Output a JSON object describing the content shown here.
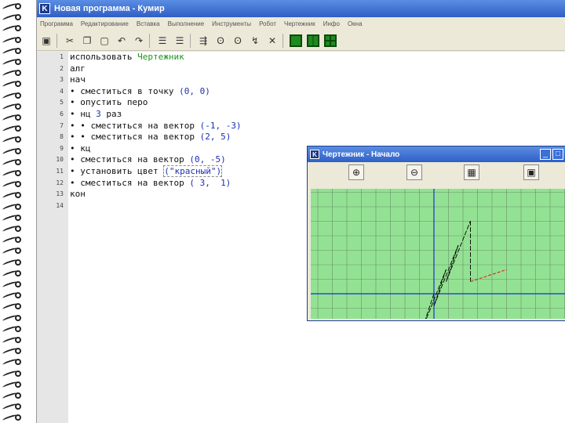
{
  "window": {
    "title": "Новая программа - Кумир",
    "icon_letter": "K"
  },
  "menu": [
    "Программа",
    "Редактирование",
    "Вставка",
    "Выполнение",
    "Инструменты",
    "Робот",
    "Чертежник",
    "Инфо",
    "Окна"
  ],
  "toolbar_icons": [
    "save-icon",
    "cut-icon",
    "copy-icon",
    "paste-icon",
    "undo-icon",
    "redo-icon",
    "indent-icon",
    "unindent-icon",
    "compile-icon",
    "run-icon",
    "step-into-icon",
    "step-over-icon",
    "stop-icon",
    "robot-window-icon",
    "drawer-window-icon",
    "field-window-icon"
  ],
  "toolbar_glyphs": [
    "▣",
    "✂",
    "❐",
    "▢",
    "↶",
    "↷",
    "☰",
    "☰",
    "⇶",
    "ʘ",
    "ʘ",
    "↯",
    "✕"
  ],
  "code": {
    "line_numbers": [
      "1",
      "2",
      "3",
      "4",
      "5",
      "6",
      "7",
      "8",
      "9",
      "10",
      "11",
      "12",
      "13",
      "14"
    ],
    "lines": [
      [
        {
          "t": "использовать ",
          "c": ""
        },
        {
          "t": "Чертежник",
          "c": "kw-green"
        }
      ],
      [
        {
          "t": "алг",
          "c": ""
        }
      ],
      [
        {
          "t": "нач",
          "c": ""
        }
      ],
      [
        {
          "t": "• сместиться в точку ",
          "c": ""
        },
        {
          "t": "(0, 0)",
          "c": "num-blue"
        }
      ],
      [
        {
          "t": "• опустить перо",
          "c": ""
        }
      ],
      [
        {
          "t": "• нц ",
          "c": ""
        },
        {
          "t": "3",
          "c": "num-blue"
        },
        {
          "t": " раз",
          "c": ""
        }
      ],
      [
        {
          "t": "• • сместиться на вектор ",
          "c": ""
        },
        {
          "t": "(-1, -3)",
          "c": "num-blue"
        }
      ],
      [
        {
          "t": "• • сместиться на вектор ",
          "c": ""
        },
        {
          "t": "(2, 5)",
          "c": "num-blue"
        }
      ],
      [
        {
          "t": "• кц",
          "c": ""
        }
      ],
      [
        {
          "t": "• сместиться на вектор ",
          "c": ""
        },
        {
          "t": "(0, -5)",
          "c": "num-blue"
        }
      ],
      [
        {
          "t": "• установить цвет ",
          "c": ""
        },
        {
          "t": "(\"красный\")",
          "c": "str-blue"
        }
      ],
      [
        {
          "t": "• сместиться на вектор ",
          "c": ""
        },
        {
          "t": "( 3,  1)",
          "c": "num-blue"
        }
      ],
      [
        {
          "t": "кон",
          "c": ""
        }
      ],
      [
        {
          "t": "",
          "c": ""
        }
      ]
    ]
  },
  "drawer": {
    "title": "Чертежник - Начало",
    "tools": [
      {
        "name": "zoom-in-icon",
        "glyph": "⊕"
      },
      {
        "name": "zoom-out-icon",
        "glyph": "⊖"
      },
      {
        "name": "ruler-icon",
        "glyph": "▦"
      },
      {
        "name": "fit-window-icon",
        "glyph": "▣"
      }
    ],
    "window_buttons": [
      "_",
      "□",
      "✕"
    ],
    "canvas_bg": "#93e293",
    "grid_color": "#6b8f6b",
    "axis_color": "#1a2fd0",
    "pen_color": "#000000",
    "red_color": "#e11414"
  }
}
